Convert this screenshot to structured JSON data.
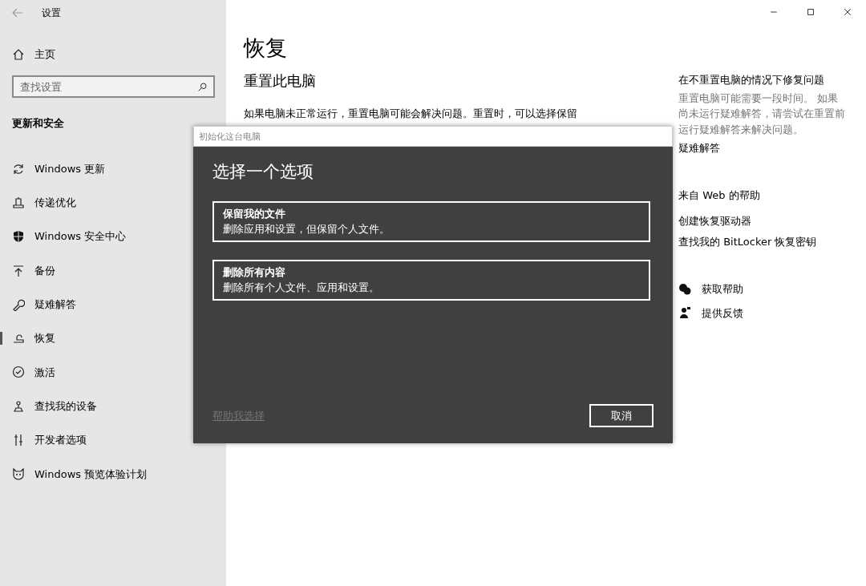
{
  "window": {
    "title": "设置"
  },
  "sidebar": {
    "home": "主页",
    "search": {
      "placeholder": "查找设置"
    },
    "section": "更新和安全",
    "items": [
      {
        "label": "Windows 更新",
        "selected": false
      },
      {
        "label": "传递优化",
        "selected": false
      },
      {
        "label": "Windows 安全中心",
        "selected": false
      },
      {
        "label": "备份",
        "selected": false
      },
      {
        "label": "疑难解答",
        "selected": false
      },
      {
        "label": "恢复",
        "selected": true
      },
      {
        "label": "激活",
        "selected": false
      },
      {
        "label": "查找我的设备",
        "selected": false
      },
      {
        "label": "开发者选项",
        "selected": false
      },
      {
        "label": "Windows 预览体验计划",
        "selected": false
      }
    ]
  },
  "main": {
    "title": "恢复",
    "subtitle": "重置此电脑",
    "body": "如果电脑未正常运行，重置电脑可能会解决问题。重置时，可以选择保留"
  },
  "aside": {
    "fix_title": "在不重置电脑的情况下修复问题",
    "fix_body": "重置电脑可能需要一段时间。 如果尚未运行疑难解答，请尝试在重置前运行疑难解答来解决问题。",
    "fix_link": "疑难解答",
    "web_title": "来自 Web 的帮助",
    "web_links": [
      "创建恢复驱动器",
      "查找我的 BitLocker 恢复密钥"
    ],
    "actions": [
      "获取帮助",
      "提供反馈"
    ]
  },
  "dialog": {
    "title": "初始化这台电脑",
    "heading": "选择一个选项",
    "options": [
      {
        "title": "保留我的文件",
        "description": "删除应用和设置，但保留个人文件。"
      },
      {
        "title": "删除所有内容",
        "description": "删除所有个人文件、应用和设置。"
      }
    ],
    "help_link": {
      "label": "帮助我选择",
      "disabled": true
    },
    "cancel": "取消"
  }
}
